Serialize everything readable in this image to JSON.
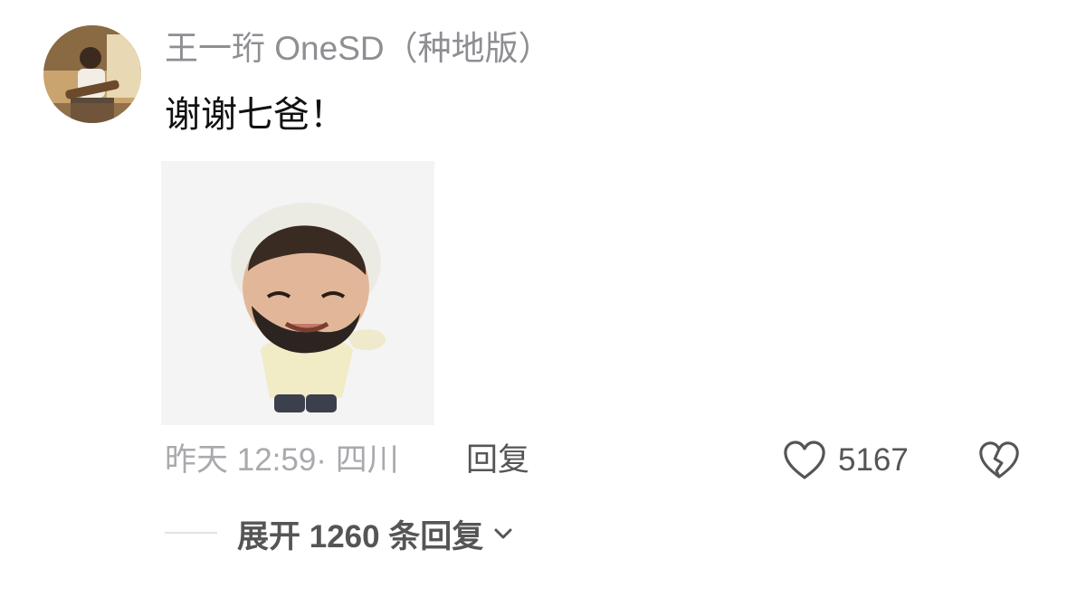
{
  "comment": {
    "username": "王一珩 OneSD（种地版）",
    "text": "谢谢七爸！",
    "sticker": "baby-face-sticker",
    "meta": "昨天 12:59· 四川",
    "reply_label": "回复",
    "like_count": "5167",
    "expand_replies_label": "展开 1260 条回复"
  },
  "icons": {
    "like": "heart-outline-icon",
    "dislike": "broken-heart-icon",
    "expand": "chevron-down-icon"
  },
  "colors": {
    "username": "#8e8e93",
    "text": "#111111",
    "meta": "#a9a9ae",
    "action": "#555555"
  }
}
